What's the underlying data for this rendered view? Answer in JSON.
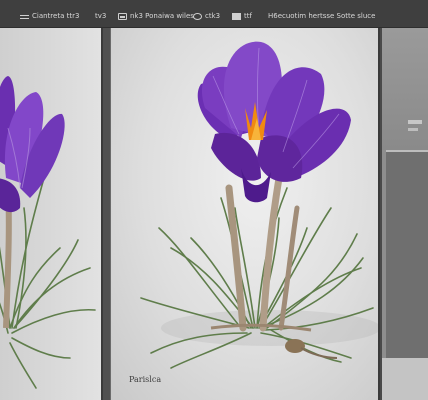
{
  "toolbar": {
    "items": [
      {
        "label": "Ciantreta ttr3",
        "icon": "menu-bars-icon"
      },
      {
        "label": "tv3",
        "icon": "arrow-right-icon"
      },
      {
        "label": "nk3  Ponaiwa wiles",
        "icon": "image-icon"
      },
      {
        "label": "ctk3",
        "icon": "circle-icon"
      },
      {
        "label": "ttf",
        "icon": "pipe-icon"
      },
      {
        "label": "H6ecuotim hertsse  Sotte sluce",
        "icon": "window-icon"
      }
    ]
  },
  "main_panel": {
    "caption": "Parislca"
  },
  "colors": {
    "petal": "#7b3fbf",
    "petal_dark": "#4b1d8a",
    "stamen": "#f08a10",
    "leaf": "#5d7a4a"
  }
}
